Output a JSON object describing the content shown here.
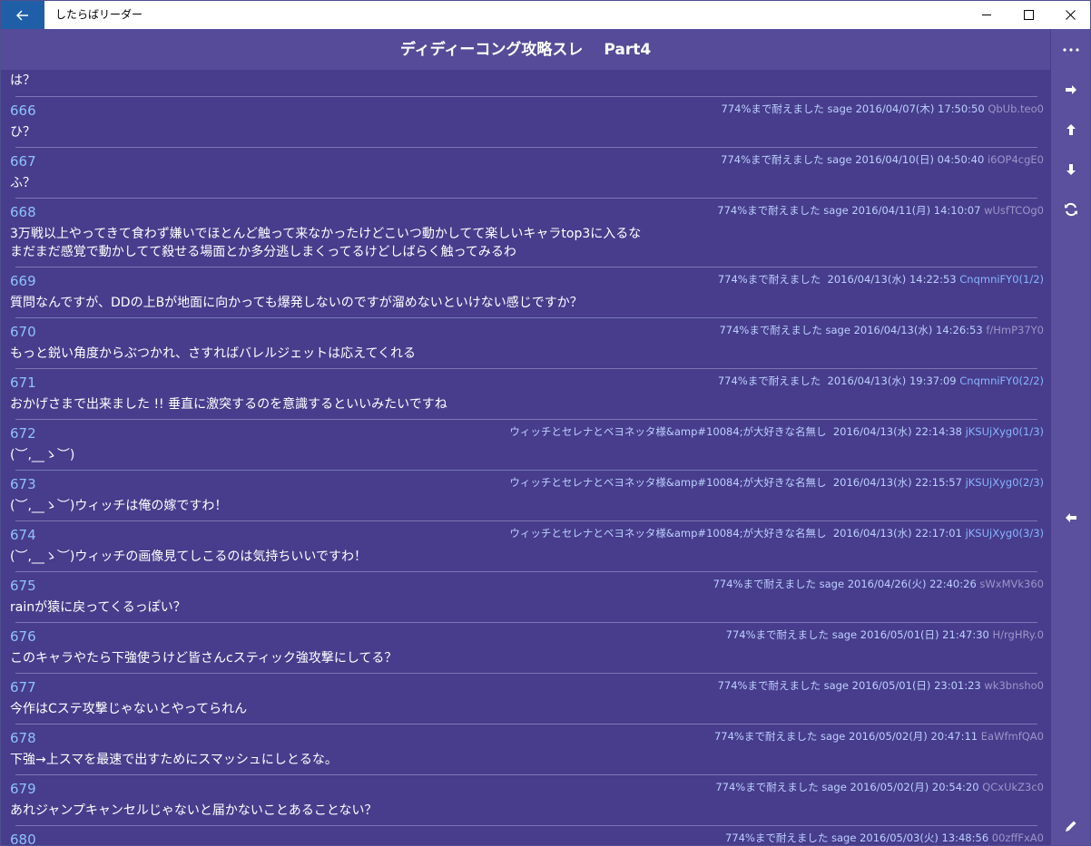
{
  "app": {
    "title": "したらばリーダー"
  },
  "header": {
    "title": "ディディーコング攻略スレ　 Part4"
  },
  "partial_top_text": "は？",
  "posts": [
    {
      "num": "666",
      "meta": "774%まで耐えました sage 2016/04/07(木) 17:50:50 ",
      "id": "QbUb.teo0",
      "body": "ひ？"
    },
    {
      "num": "667",
      "meta": "774%まで耐えました sage 2016/04/10(日) 04:50:40 ",
      "id": "i6OP4cgE0",
      "body": "ふ？"
    },
    {
      "num": "668",
      "meta": "774%まで耐えました sage 2016/04/11(月) 14:10:07 ",
      "id": "wUsfTCOg0",
      "body": "3万戦以上やってきて食わず嫌いでほとんど触って来なかったけどこいつ動かしてて楽しいキャラtop3に入るな\nまだまだ感覚で動かしてて殺せる場面とか多分逃しまくってるけどしばらく触ってみるわ"
    },
    {
      "num": "669",
      "meta": "774%まで耐えました  2016/04/13(水) 14:22:53 ",
      "id": "CnqmniFY0(1/2)",
      "body": "質問なんですが、DDの上Bが地面に向かっても爆発しないのですが溜めないといけない感じですか？"
    },
    {
      "num": "670",
      "meta": "774%まで耐えました sage 2016/04/13(水) 14:26:53 ",
      "id": "f/HmP37Y0",
      "body": "もっと鋭い角度からぶつかれ、さすればバレルジェットは応えてくれる"
    },
    {
      "num": "671",
      "meta": "774%まで耐えました  2016/04/13(水) 19:37:09 ",
      "id": "CnqmniFY0(2/2)",
      "body": "おかげさまで出来ました !! 垂直に激突するのを意識するといいみたいですね"
    },
    {
      "num": "672",
      "meta": "ウィッチとセレナとベヨネッタ様&amp#10084;が大好きな名無し  2016/04/13(水) 22:14:38 ",
      "id": "jKSUjXyg0(1/3)",
      "body": "(︶,__ゝ︶)"
    },
    {
      "num": "673",
      "meta": "ウィッチとセレナとベヨネッタ様&amp#10084;が大好きな名無し  2016/04/13(水) 22:15:57 ",
      "id": "jKSUjXyg0(2/3)",
      "body": "(︶,__ゝ︶)ウィッチは俺の嫁ですわ！"
    },
    {
      "num": "674",
      "meta": "ウィッチとセレナとベヨネッタ様&amp#10084;が大好きな名無し  2016/04/13(水) 22:17:01 ",
      "id": "jKSUjXyg0(3/3)",
      "body": "(︶,__ゝ︶)ウィッチの画像見てしこるのは気持ちいいですわ！"
    },
    {
      "num": "675",
      "meta": "774%まで耐えました sage 2016/04/26(火) 22:40:26 ",
      "id": "sWxMVk360",
      "body": "rainが猿に戻ってくるっぽい？"
    },
    {
      "num": "676",
      "meta": "774%まで耐えました sage 2016/05/01(日) 21:47:30 ",
      "id": "H/rgHRy.0",
      "body": "このキャラやたら下強使うけど皆さんcスティック強攻撃にしてる？"
    },
    {
      "num": "677",
      "meta": "774%まで耐えました sage 2016/05/01(日) 23:01:23 ",
      "id": "wk3bnsho0",
      "body": "今作はCステ攻撃じゃないとやってられん"
    },
    {
      "num": "678",
      "meta": "774%まで耐えました sage 2016/05/02(月) 20:47:11 ",
      "id": "EaWfmfQA0",
      "body": "下強→上スマを最速で出すためにスマッシュにしとるな。"
    },
    {
      "num": "679",
      "meta": "774%まで耐えました sage 2016/05/02(月) 20:54:20 ",
      "id": "QCxUkZ3c0",
      "body": "あれジャンプキャンセルじゃないと届かないことあることない？"
    },
    {
      "num": "680",
      "meta": "774%まで耐えました sage 2016/05/03(火) 13:48:56 ",
      "id": "00zffFxA0",
      "body": ""
    }
  ],
  "icons": {
    "back": "back-arrow-icon",
    "more": "more-icon",
    "next": "arrow-right-icon",
    "top": "arrow-up-icon",
    "bottom": "arrow-down-icon",
    "refresh": "refresh-icon",
    "prev": "arrow-left-icon",
    "write": "pencil-icon"
  },
  "colors": {
    "background": "#473d8c",
    "header": "#564b98",
    "commandbar": "#5b509d",
    "post_number": "#8fc1ff",
    "id_linked": "#87b5ff"
  }
}
